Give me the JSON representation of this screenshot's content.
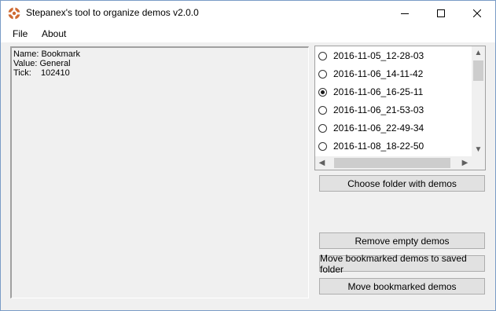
{
  "window": {
    "title": "Stepanex's tool to organize demos v2.0.0"
  },
  "menu": {
    "file": "File",
    "about": "About"
  },
  "info": {
    "name_label": "Name:",
    "name_value": "Bookmark",
    "value_label": "Value:",
    "value_value": "General",
    "tick_label": "Tick:",
    "tick_value": "102410"
  },
  "demos": [
    {
      "label": "2016-11-05_12-28-03",
      "selected": false
    },
    {
      "label": "2016-11-06_14-11-42",
      "selected": false
    },
    {
      "label": "2016-11-06_16-25-11",
      "selected": true
    },
    {
      "label": "2016-11-06_21-53-03",
      "selected": false
    },
    {
      "label": "2016-11-06_22-49-34",
      "selected": false
    },
    {
      "label": "2016-11-08_18-22-50",
      "selected": false
    }
  ],
  "buttons": {
    "choose_folder": "Choose folder with demos",
    "remove_empty": "Remove empty demos",
    "move_to_saved": "Move bookmarked demos to saved folder",
    "move_bookmarked": "Move bookmarked demos"
  },
  "icons": {
    "app": "tf2-logo-icon",
    "minimize": "minimize-icon",
    "maximize": "maximize-icon",
    "close": "close-icon",
    "scroll_up": "chevron-up-icon",
    "scroll_down": "chevron-down-icon",
    "scroll_left": "chevron-left-icon",
    "scroll_right": "chevron-right-icon"
  },
  "colors": {
    "app_icon": "#cf6a32",
    "window_border": "#7a9cc6",
    "button_bg": "#e1e1e1"
  }
}
